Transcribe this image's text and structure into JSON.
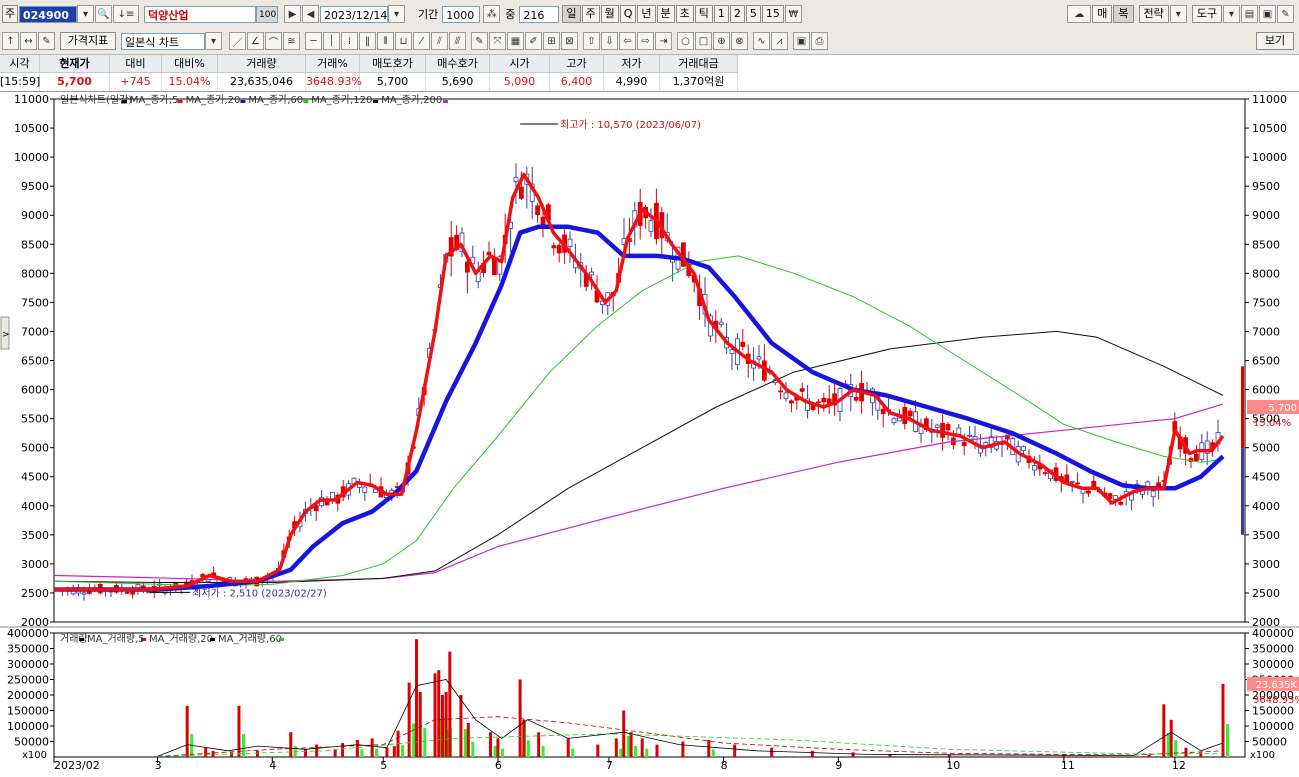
{
  "toolbar1": {
    "mode_label": "주",
    "code": "024900",
    "stock_name": "덕양산업",
    "zoom": "100",
    "date": "2023/12/14",
    "period_label": "기간",
    "period": "1000",
    "count_label": "중",
    "count": "216",
    "period_units": [
      "일",
      "주",
      "월",
      "Q",
      "년",
      "분",
      "초",
      "틱",
      "1",
      "2",
      "5",
      "15"
    ],
    "active_unit": "일",
    "right_buttons": [
      "매",
      "복",
      "전략",
      "도구"
    ]
  },
  "toolbar2": {
    "indicator_label": "가격지표",
    "chart_type": "일본식 차트",
    "view_label": "보기"
  },
  "quote": {
    "headers": [
      "시각",
      "현재가",
      "대비",
      "대비%",
      "거래량",
      "거래%",
      "매도호가",
      "매수호가",
      "시가",
      "고가",
      "저가",
      "거래대금"
    ],
    "values": [
      "[15:59]",
      "5,700",
      "+745",
      "15.04%",
      "23,635,046",
      "3648.93%",
      "5,700",
      "5,690",
      "5,090",
      "6,400",
      "4,990",
      "1,370억원"
    ]
  },
  "colors": {
    "candle_up": "#e00000",
    "candle_down": "#3a3aa8",
    "ma5": "#ee1111",
    "ma20": "#1515dd",
    "ma60": "#22cc22",
    "ma120": "#111111",
    "ma200": "#cc22cc",
    "vol_bar": "#dd0000",
    "vol_down": "#33ee33"
  },
  "chart_data": [
    {
      "type": "candlestick",
      "legend": [
        "일본식차트(일간)",
        "MA_종가,5",
        "MA_종가,20",
        "MA_종가,60",
        "MA_종가,120",
        "MA_종가,200"
      ],
      "ylim": [
        2000,
        11000
      ],
      "yticks": [
        2000,
        2500,
        3000,
        3500,
        4000,
        4500,
        5000,
        5500,
        6000,
        6500,
        7000,
        7500,
        8000,
        8500,
        9000,
        9500,
        10000,
        10500,
        11000
      ],
      "xticks": [
        "2023/02",
        "3",
        "4",
        "5",
        "6",
        "7",
        "8",
        "9",
        "10",
        "11",
        "12"
      ],
      "annotation_high": "최고가 : 10,570 (2023/06/07)",
      "annotation_low": "최저가 : 2,510 (2023/02/27)",
      "last_price_label": "5,700",
      "last_change_label": "15.04%",
      "series": [
        {
          "name": "MA_종가,5",
          "points": [
            [
              "02/01",
              2560
            ],
            [
              "02/27",
              2560
            ],
            [
              "03/09",
              2620
            ],
            [
              "03/15",
              2800
            ],
            [
              "03/21",
              2700
            ],
            [
              "03/28",
              2700
            ],
            [
              "04/03",
              2900
            ],
            [
              "04/06",
              3500
            ],
            [
              "04/10",
              3900
            ],
            [
              "04/14",
              4100
            ],
            [
              "04/18",
              4100
            ],
            [
              "04/24",
              4400
            ],
            [
              "04/28",
              4350
            ],
            [
              "05/02",
              4200
            ],
            [
              "05/06",
              4200
            ],
            [
              "05/10",
              5300
            ],
            [
              "05/15",
              7000
            ],
            [
              "05/18",
              8300
            ],
            [
              "05/22",
              8500
            ],
            [
              "05/26",
              8000
            ],
            [
              "05/30",
              8300
            ],
            [
              "06/02",
              8200
            ],
            [
              "06/05",
              9300
            ],
            [
              "06/08",
              9700
            ],
            [
              "06/12",
              9300
            ],
            [
              "06/16",
              8700
            ],
            [
              "06/20",
              8400
            ],
            [
              "06/26",
              7900
            ],
            [
              "06/30",
              7500
            ],
            [
              "07/03",
              7700
            ],
            [
              "07/06",
              8600
            ],
            [
              "07/10",
              9100
            ],
            [
              "07/14",
              8900
            ],
            [
              "07/18",
              8500
            ],
            [
              "07/24",
              8000
            ],
            [
              "07/28",
              7200
            ],
            [
              "08/02",
              6800
            ],
            [
              "08/08",
              6500
            ],
            [
              "08/14",
              6300
            ],
            [
              "08/18",
              6000
            ],
            [
              "08/23",
              5800
            ],
            [
              "08/28",
              5700
            ],
            [
              "09/01",
              5800
            ],
            [
              "09/05",
              6000
            ],
            [
              "09/11",
              5900
            ],
            [
              "09/15",
              5600
            ],
            [
              "09/20",
              5500
            ],
            [
              "09/26",
              5300
            ],
            [
              "10/04",
              5200
            ],
            [
              "10/10",
              5000
            ],
            [
              "10/16",
              5100
            ],
            [
              "10/20",
              4900
            ],
            [
              "10/26",
              4700
            ],
            [
              "11/01",
              4400
            ],
            [
              "11/06",
              4300
            ],
            [
              "11/10",
              4300
            ],
            [
              "11/14",
              4050
            ],
            [
              "11/20",
              4250
            ],
            [
              "11/24",
              4300
            ],
            [
              "11/28",
              4300
            ],
            [
              "12/01",
              5300
            ],
            [
              "12/05",
              4900
            ],
            [
              "12/07",
              4950
            ],
            [
              "12/11",
              4950
            ],
            [
              "12/14",
              5200
            ]
          ]
        },
        {
          "name": "MA_종가,20",
          "points": [
            [
              "02/01",
              2560
            ],
            [
              "03/01",
              2560
            ],
            [
              "03/15",
              2620
            ],
            [
              "03/28",
              2700
            ],
            [
              "04/06",
              2900
            ],
            [
              "04/12",
              3300
            ],
            [
              "04/20",
              3700
            ],
            [
              "04/28",
              3900
            ],
            [
              "05/04",
              4200
            ],
            [
              "05/10",
              4600
            ],
            [
              "05/18",
              5800
            ],
            [
              "05/26",
              6800
            ],
            [
              "06/02",
              7800
            ],
            [
              "06/07",
              8700
            ],
            [
              "06/12",
              8800
            ],
            [
              "06/20",
              8800
            ],
            [
              "06/28",
              8700
            ],
            [
              "07/05",
              8300
            ],
            [
              "07/14",
              8300
            ],
            [
              "07/21",
              8250
            ],
            [
              "07/28",
              8100
            ],
            [
              "08/04",
              7600
            ],
            [
              "08/14",
              6800
            ],
            [
              "08/25",
              6300
            ],
            [
              "09/05",
              6000
            ],
            [
              "09/14",
              5900
            ],
            [
              "09/25",
              5700
            ],
            [
              "10/06",
              5500
            ],
            [
              "10/18",
              5250
            ],
            [
              "10/30",
              4900
            ],
            [
              "11/08",
              4600
            ],
            [
              "11/17",
              4350
            ],
            [
              "11/24",
              4300
            ],
            [
              "12/01",
              4300
            ],
            [
              "12/08",
              4500
            ],
            [
              "12/14",
              4850
            ]
          ]
        },
        {
          "name": "MA_종가,60",
          "points": [
            [
              "02/01",
              2700
            ],
            [
              "03/01",
              2650
            ],
            [
              "03/15",
              2620
            ],
            [
              "04/01",
              2650
            ],
            [
              "04/20",
              2800
            ],
            [
              "05/01",
              3000
            ],
            [
              "05/10",
              3400
            ],
            [
              "05/20",
              4300
            ],
            [
              "06/01",
              5200
            ],
            [
              "06/15",
              6300
            ],
            [
              "06/28",
              7100
            ],
            [
              "07/10",
              7700
            ],
            [
              "07/25",
              8200
            ],
            [
              "08/05",
              8300
            ],
            [
              "08/20",
              8000
            ],
            [
              "09/05",
              7600
            ],
            [
              "09/20",
              7100
            ],
            [
              "10/05",
              6500
            ],
            [
              "10/20",
              5900
            ],
            [
              "11/01",
              5400
            ],
            [
              "11/15",
              5100
            ],
            [
              "11/28",
              4850
            ],
            [
              "12/08",
              4750
            ],
            [
              "12/14",
              4800
            ]
          ]
        },
        {
          "name": "MA_종가,120",
          "points": [
            [
              "02/01",
              2700
            ],
            [
              "03/01",
              2680
            ],
            [
              "04/01",
              2680
            ],
            [
              "05/01",
              2750
            ],
            [
              "05/15",
              2880
            ],
            [
              "06/01",
              3500
            ],
            [
              "06/20",
              4300
            ],
            [
              "07/10",
              5000
            ],
            [
              "07/30",
              5700
            ],
            [
              "08/20",
              6300
            ],
            [
              "09/15",
              6700
            ],
            [
              "10/10",
              6900
            ],
            [
              "10/30",
              7000
            ],
            [
              "11/10",
              6900
            ],
            [
              "11/28",
              6400
            ],
            [
              "12/14",
              5900
            ]
          ]
        },
        {
          "name": "MA_종가,200",
          "points": [
            [
              "02/01",
              2800
            ],
            [
              "03/01",
              2760
            ],
            [
              "04/01",
              2700
            ],
            [
              "05/01",
              2750
            ],
            [
              "05/15",
              2850
            ],
            [
              "06/01",
              3300
            ],
            [
              "07/01",
              3800
            ],
            [
              "08/01",
              4300
            ],
            [
              "09/01",
              4750
            ],
            [
              "10/01",
              5100
            ],
            [
              "11/01",
              5300
            ],
            [
              "12/01",
              5500
            ],
            [
              "12/14",
              5750
            ]
          ]
        }
      ]
    },
    {
      "type": "bar",
      "legend": [
        "거래량",
        "MA_거래량,5",
        "MA_거래량,20",
        "MA_거래량,60"
      ],
      "ylim": [
        0,
        400000
      ],
      "yticks": [
        50000,
        100000,
        150000,
        200000,
        250000,
        300000,
        350000,
        400000
      ],
      "scale_label": "x100",
      "last_volume_label": "23,635K",
      "last_ratio_label": "3648.93%",
      "values": [
        [
          "03/09",
          165000
        ],
        [
          "03/14",
          30000
        ],
        [
          "03/16",
          20000
        ],
        [
          "03/21",
          15000
        ],
        [
          "03/23",
          165000
        ],
        [
          "03/28",
          20000
        ],
        [
          "04/06",
          80000
        ],
        [
          "04/10",
          25000
        ],
        [
          "04/13",
          40000
        ],
        [
          "04/18",
          25000
        ],
        [
          "04/20",
          45000
        ],
        [
          "04/24",
          55000
        ],
        [
          "04/28",
          60000
        ],
        [
          "05/02",
          30000
        ],
        [
          "05/04",
          35000
        ],
        [
          "05/05",
          85000
        ],
        [
          "05/08",
          240000
        ],
        [
          "05/10",
          380000
        ],
        [
          "05/11",
          210000
        ],
        [
          "05/15",
          270000
        ],
        [
          "05/16",
          280000
        ],
        [
          "05/17",
          200000
        ],
        [
          "05/18",
          210000
        ],
        [
          "05/19",
          340000
        ],
        [
          "05/22",
          200000
        ],
        [
          "05/24",
          110000
        ],
        [
          "05/30",
          80000
        ],
        [
          "06/01",
          60000
        ],
        [
          "06/07",
          250000
        ],
        [
          "06/08",
          120000
        ],
        [
          "06/12",
          80000
        ],
        [
          "06/20",
          60000
        ],
        [
          "06/28",
          40000
        ],
        [
          "07/03",
          60000
        ],
        [
          "07/05",
          150000
        ],
        [
          "07/07",
          80000
        ],
        [
          "07/10",
          60000
        ],
        [
          "07/14",
          40000
        ],
        [
          "07/21",
          50000
        ],
        [
          "07/28",
          55000
        ],
        [
          "08/04",
          40000
        ],
        [
          "08/14",
          30000
        ],
        [
          "08/25",
          20000
        ],
        [
          "09/05",
          15000
        ],
        [
          "09/15",
          10000
        ],
        [
          "10/01",
          8000
        ],
        [
          "11/01",
          6000
        ],
        [
          "11/24",
          8000
        ],
        [
          "11/28",
          170000
        ],
        [
          "11/30",
          120000
        ],
        [
          "12/04",
          30000
        ],
        [
          "12/08",
          15000
        ],
        [
          "12/14",
          236000
        ]
      ]
    }
  ]
}
